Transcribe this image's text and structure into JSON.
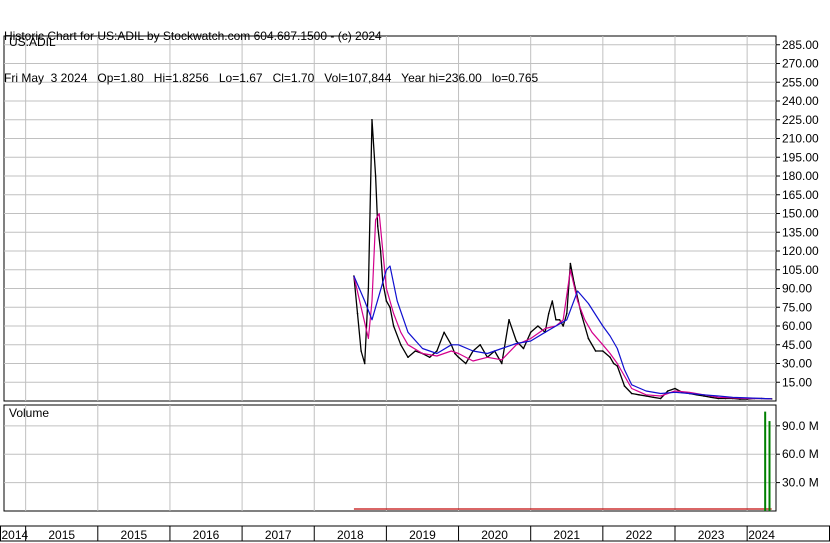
{
  "header": {
    "title": "Historic Chart for US:ADIL by Stockwatch.com 604.687.1500 - (c) 2024",
    "date": "Fri May  3 2024",
    "open": "Op=1.80",
    "high": "Hi=1.8256",
    "low": "Lo=1.67",
    "close": "Cl=1.70",
    "volume": "Vol=107,844",
    "year_high": "Year hi=236.00",
    "year_low": "lo=0.765"
  },
  "colors": {
    "price": "#000000",
    "ma_short": "#d4008c",
    "ma_long": "#1010d0",
    "volume_up": "#008000",
    "volume_down": "#c00000",
    "grid": "#c0c0c0"
  },
  "chart_data": [
    {
      "type": "line",
      "title": "US:ADIL",
      "ylim": [
        0,
        292
      ],
      "y_ticks": [
        "285.00",
        "270.00",
        "255.00",
        "240.00",
        "225.00",
        "210.00",
        "195.00",
        "180.00",
        "165.00",
        "150.00",
        "135.00",
        "120.00",
        "105.00",
        "90.00",
        "75.00",
        "60.00",
        "45.00",
        "30.00",
        "15.00"
      ],
      "y_tick_values": [
        285,
        270,
        255,
        240,
        225,
        210,
        195,
        180,
        165,
        150,
        135,
        120,
        105,
        90,
        75,
        60,
        45,
        30,
        15
      ],
      "x_labels": [
        "2014",
        "2015",
        "2016",
        "2017",
        "2018",
        "2019",
        "2020",
        "2021",
        "2022",
        "2023",
        "2024"
      ],
      "x_label_values": [
        2014,
        2015,
        2016,
        2017,
        2018,
        2019,
        2020,
        2021,
        2022,
        2023,
        2024
      ],
      "xlim": [
        2013.7,
        2024.4
      ],
      "grid": true,
      "series": [
        {
          "role": "price",
          "x": [
            2018.55,
            2018.6,
            2018.65,
            2018.7,
            2018.75,
            2018.8,
            2018.85,
            2018.88,
            2018.92,
            2018.95,
            2019.0,
            2019.05,
            2019.1,
            2019.2,
            2019.3,
            2019.4,
            2019.5,
            2019.6,
            2019.7,
            2019.8,
            2019.9,
            2019.95,
            2020.0,
            2020.1,
            2020.2,
            2020.3,
            2020.4,
            2020.5,
            2020.6,
            2020.7,
            2020.8,
            2020.9,
            2021.0,
            2021.1,
            2021.2,
            2021.25,
            2021.3,
            2021.35,
            2021.4,
            2021.45,
            2021.5,
            2021.55,
            2021.6,
            2021.7,
            2021.8,
            2021.9,
            2022.0,
            2022.1,
            2022.15,
            2022.2,
            2022.3,
            2022.4,
            2022.5,
            2022.6,
            2022.7,
            2022.8,
            2022.9,
            2023.0,
            2023.1,
            2023.2,
            2023.3,
            2023.4,
            2023.5,
            2023.6,
            2023.7,
            2023.8,
            2023.9,
            2024.0,
            2024.1,
            2024.2,
            2024.3,
            2024.34
          ],
          "values": [
            100,
            70,
            40,
            30,
            90,
            225,
            180,
            140,
            120,
            95,
            80,
            75,
            60,
            45,
            35,
            40,
            38,
            35,
            40,
            55,
            45,
            38,
            35,
            30,
            40,
            45,
            35,
            40,
            30,
            65,
            48,
            42,
            55,
            60,
            55,
            70,
            80,
            65,
            65,
            60,
            70,
            110,
            95,
            70,
            50,
            40,
            40,
            35,
            30,
            28,
            12,
            6,
            5,
            4,
            3,
            2,
            8,
            10,
            7,
            6,
            5,
            4,
            3,
            2,
            2,
            2,
            1.5,
            1.5,
            2,
            2,
            1.8,
            1.7
          ]
        },
        {
          "role": "short_ma",
          "x": [
            2018.55,
            2018.65,
            2018.75,
            2018.8,
            2018.85,
            2018.9,
            2018.95,
            2019.0,
            2019.1,
            2019.2,
            2019.3,
            2019.5,
            2019.7,
            2019.9,
            2020.0,
            2020.2,
            2020.4,
            2020.6,
            2020.8,
            2021.0,
            2021.2,
            2021.35,
            2021.45,
            2021.55,
            2021.65,
            2021.75,
            2021.85,
            2022.0,
            2022.1,
            2022.2,
            2022.3,
            2022.4,
            2022.6,
            2022.8,
            2023.0,
            2023.2,
            2023.4,
            2023.6,
            2023.8,
            2024.0,
            2024.2,
            2024.34
          ],
          "values": [
            100,
            75,
            50,
            80,
            145,
            150,
            120,
            90,
            70,
            55,
            45,
            38,
            36,
            40,
            38,
            32,
            35,
            33,
            45,
            50,
            58,
            60,
            65,
            105,
            80,
            65,
            55,
            45,
            38,
            30,
            20,
            10,
            5,
            4,
            8,
            7,
            5,
            3,
            2.5,
            2,
            2,
            1.8
          ]
        },
        {
          "role": "long_ma",
          "x": [
            2018.55,
            2018.7,
            2018.8,
            2018.9,
            2019.0,
            2019.05,
            2019.15,
            2019.3,
            2019.5,
            2019.7,
            2019.9,
            2020.0,
            2020.2,
            2020.4,
            2020.6,
            2020.8,
            2021.0,
            2021.2,
            2021.35,
            2021.5,
            2021.65,
            2021.8,
            2022.0,
            2022.1,
            2022.2,
            2022.3,
            2022.4,
            2022.6,
            2022.8,
            2023.0,
            2023.2,
            2023.4,
            2023.6,
            2023.8,
            2024.0,
            2024.2,
            2024.34
          ],
          "values": [
            100,
            80,
            65,
            85,
            105,
            108,
            80,
            55,
            42,
            38,
            45,
            45,
            40,
            38,
            42,
            46,
            48,
            55,
            60,
            65,
            88,
            78,
            60,
            52,
            42,
            25,
            13,
            8,
            6,
            7,
            6,
            5,
            4,
            3,
            2.5,
            2,
            1.8
          ]
        }
      ]
    },
    {
      "type": "bar",
      "title": "Volume",
      "ylim": [
        0,
        112
      ],
      "y_ticks": [
        "90.0 M",
        "60.0 M",
        "30.0 M"
      ],
      "y_tick_values": [
        90,
        60,
        30
      ],
      "x": [
        2024.25,
        2024.31
      ],
      "values": [
        105,
        95
      ]
    }
  ]
}
